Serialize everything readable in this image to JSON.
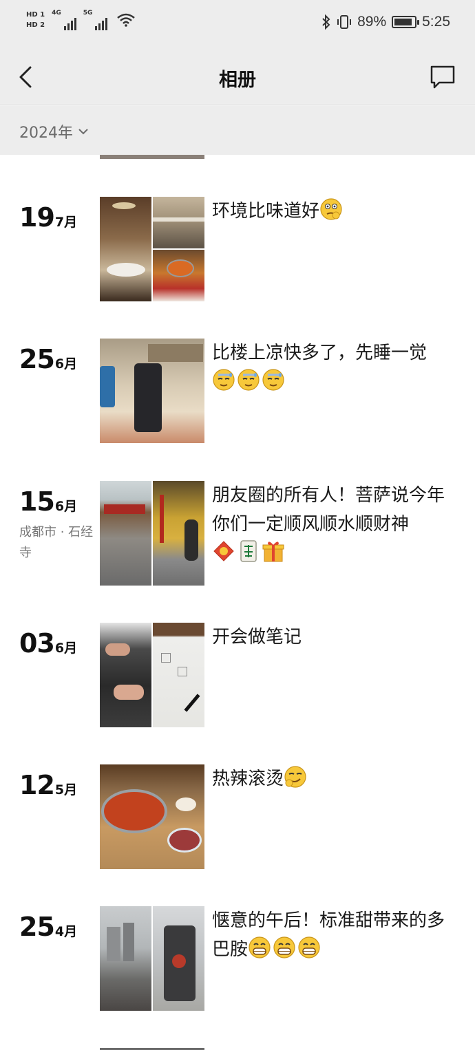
{
  "status_bar": {
    "hd1": "HD 1",
    "hd2": "HD 2",
    "net1": "4G",
    "net2": "5G",
    "battery_text": "89%",
    "battery_level": 0.89,
    "time": "5:25"
  },
  "nav": {
    "title": "相册"
  },
  "filter": {
    "year": "2024年"
  },
  "posts": [
    {
      "day": "19",
      "month": "7月",
      "location": "",
      "text": "环境比味道好",
      "emojis": [
        "thinking-face"
      ],
      "layout": "1-2"
    },
    {
      "day": "25",
      "month": "6月",
      "location": "",
      "text": "比楼上凉快多了，先睡一觉",
      "emojis": [
        "sweat-face",
        "sweat-face",
        "sweat-face"
      ],
      "layout": "1"
    },
    {
      "day": "15",
      "month": "6月",
      "location": "成都市 · 石经寺",
      "text": "朋友圈的所有人！菩萨说今年你们一定顺风顺水顺财神",
      "emojis": [
        "fortune-icon",
        "mahjong-fa-icon",
        "gift-icon"
      ],
      "layout": "1-1"
    },
    {
      "day": "03",
      "month": "6月",
      "location": "",
      "text": "开会做笔记",
      "emojis": [],
      "layout": "1-1"
    },
    {
      "day": "12",
      "month": "5月",
      "location": "",
      "text": "热辣滚烫",
      "emojis": [
        "smirk-face"
      ],
      "layout": "1"
    },
    {
      "day": "25",
      "month": "4月",
      "location": "",
      "text": "惬意的午后！标准甜带来的多巴胺",
      "emojis": [
        "grin-face",
        "grin-face",
        "grin-face"
      ],
      "layout": "1-1"
    }
  ]
}
